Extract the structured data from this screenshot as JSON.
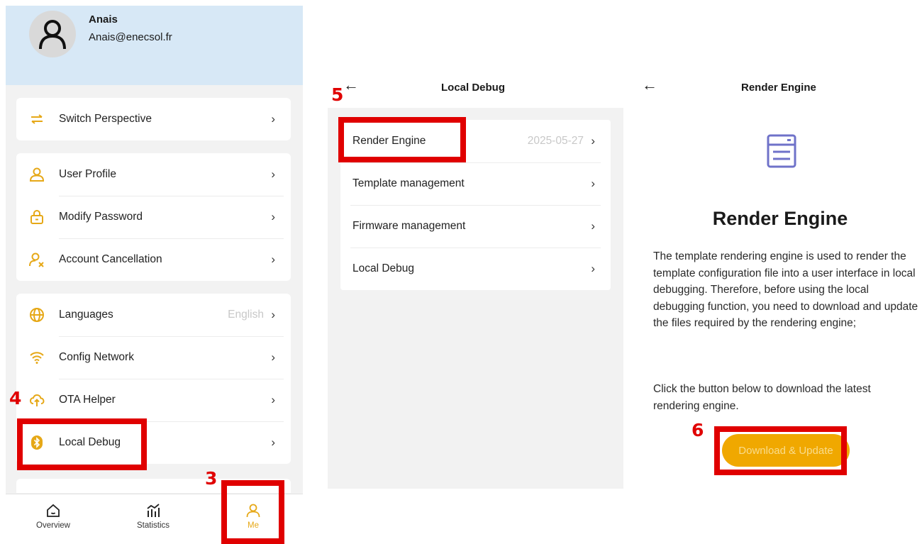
{
  "me_panel": {
    "user": {
      "name": "Anais",
      "email": "Anais@enecsol.fr"
    },
    "groups": [
      [
        {
          "label": "Switch Perspective",
          "icon": "switch-icon"
        }
      ],
      [
        {
          "label": "User Profile",
          "icon": "user-icon"
        },
        {
          "label": "Modify Password",
          "icon": "lock-icon"
        },
        {
          "label": "Account Cancellation",
          "icon": "user-remove-icon"
        }
      ],
      [
        {
          "label": "Languages",
          "value": "English",
          "icon": "globe-icon"
        },
        {
          "label": "Config Network",
          "icon": "wifi-icon"
        },
        {
          "label": "OTA Helper",
          "icon": "cloud-upload-icon"
        },
        {
          "label": "Local Debug",
          "icon": "bluetooth-icon"
        }
      ]
    ],
    "tabs": [
      {
        "label": "Overview",
        "icon": "home-icon"
      },
      {
        "label": "Statistics",
        "icon": "bar-chart-icon"
      },
      {
        "label": "Me",
        "icon": "person-icon",
        "active": true
      }
    ],
    "accent": "#E6A817"
  },
  "local_debug_panel": {
    "title": "Local Debug",
    "items": [
      {
        "label": "Render Engine",
        "value": "2025-05-27"
      },
      {
        "label": "Template management"
      },
      {
        "label": "Firmware management"
      },
      {
        "label": "Local Debug"
      }
    ]
  },
  "render_engine_panel": {
    "title": "Render Engine",
    "heading": "Render Engine",
    "description": "The template rendering engine is used to render the template configuration file into a user interface in local debugging. Therefore, before using the local debugging function, you need to download and update the files required by the rendering engine;",
    "instruction": "Click the button below to download the latest rendering engine.",
    "button_label": "Download & Update",
    "button_color": "#F0A800"
  },
  "annotations": {
    "step_3": "3",
    "step_4": "4",
    "step_5": "5",
    "step_6": "6",
    "color": "#E00000"
  }
}
